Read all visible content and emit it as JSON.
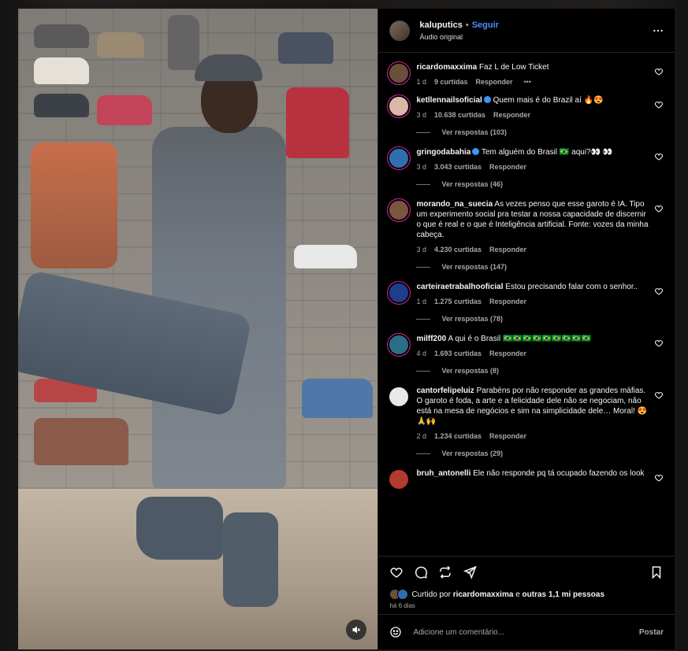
{
  "post": {
    "username": "kaluputics",
    "dot": "•",
    "follow_label": "Seguir",
    "audio": "Áudio original",
    "more_icon": "more-horizontal-icon"
  },
  "comments": [
    {
      "user": "ricardomaxxima",
      "text": "Faz L de Low Ticket",
      "age": "1 d",
      "likes": "9 curtidas",
      "reply": "Responder",
      "show_more": "•••",
      "replies": "",
      "avatar_color": "#6b4f3a"
    },
    {
      "user": "ketllennailsoficial",
      "verified": true,
      "text": "Quem mais é do Brazil aí 🔥😍",
      "age": "3 d",
      "likes": "10.638 curtidas",
      "reply": "Responder",
      "replies": "Ver respostas (103)",
      "avatar_color": "#d9b8a8"
    },
    {
      "user": "gringodabahia",
      "verified": true,
      "text": "Tem alguém do Brasil 🇧🇷 aqui?👀 👀",
      "age": "3 d",
      "likes": "3.043 curtidas",
      "reply": "Responder",
      "replies": "Ver respostas (46)",
      "avatar_color": "#2f6fb0"
    },
    {
      "user": "morando_na_suecia",
      "text": "As vezes penso que esse garoto é IA. Tipo um experimento social pra testar a nossa capacidade de discernir o que é real e o que é Inteligência artificial. Fonte: vozes da minha cabeça.",
      "age": "3 d",
      "likes": "4.230 curtidas",
      "reply": "Responder",
      "replies": "Ver respostas (147)",
      "avatar_color": "#7a5540"
    },
    {
      "user": "carteiraetrabalhooficial",
      "text": "Estou precisando falar com o senhor..",
      "age": "1 d",
      "likes": "1.275 curtidas",
      "reply": "Responder",
      "replies": "Ver respostas (78)",
      "avatar_color": "#1d3f8a"
    },
    {
      "user": "milff200",
      "text": "A qui é o Brasil 🇧🇷🇧🇷🇧🇷🇧🇷🇧🇷🇧🇷🇧🇷🇧🇷🇧🇷",
      "age": "4 d",
      "likes": "1.693 curtidas",
      "reply": "Responder",
      "replies": "Ver respostas (8)",
      "avatar_color": "#2a6f86"
    },
    {
      "user": "cantorfelipeluiz",
      "text": "Parabéns por não responder as grandes máfias. O garoto é foda, a arte e a felicidade dele não se negociam, não está na mesa de negócios e sim na simplicidade dele… Moral! 😍🙏🙌",
      "age": "2 d",
      "likes": "1.234 curtidas",
      "reply": "Responder",
      "replies": "Ver respostas (29)",
      "avatar_color": "#e8e8e8",
      "no_ring": true
    },
    {
      "user": "bruh_antonelli",
      "text": "Ele não responde pq tá ocupado fazendo os look",
      "age": "",
      "likes": "",
      "reply": "",
      "replies": "",
      "avatar_color": "#b33a2e",
      "no_ring": true
    }
  ],
  "actions": {
    "like_icon": "heart-icon",
    "comment_icon": "comment-icon",
    "share_icon": "repost-icon",
    "send_icon": "send-icon",
    "save_icon": "bookmark-icon"
  },
  "liked_by": {
    "prefix": "Curtido por",
    "user": "ricardomaxxima",
    "middle": "e",
    "others": "outras 1,1 mi pessoas"
  },
  "time_ago": "há 6 dias",
  "add_comment": {
    "placeholder": "Adicione um comentário...",
    "post_label": "Postar",
    "emoji_icon": "emoji-icon"
  },
  "media": {
    "mute_icon": "volume-muted-icon"
  },
  "colors": {
    "accent": "#4f8ef7",
    "story_ring": "#d6249f",
    "background": "#000000",
    "muted_text": "#a8a8a8"
  }
}
